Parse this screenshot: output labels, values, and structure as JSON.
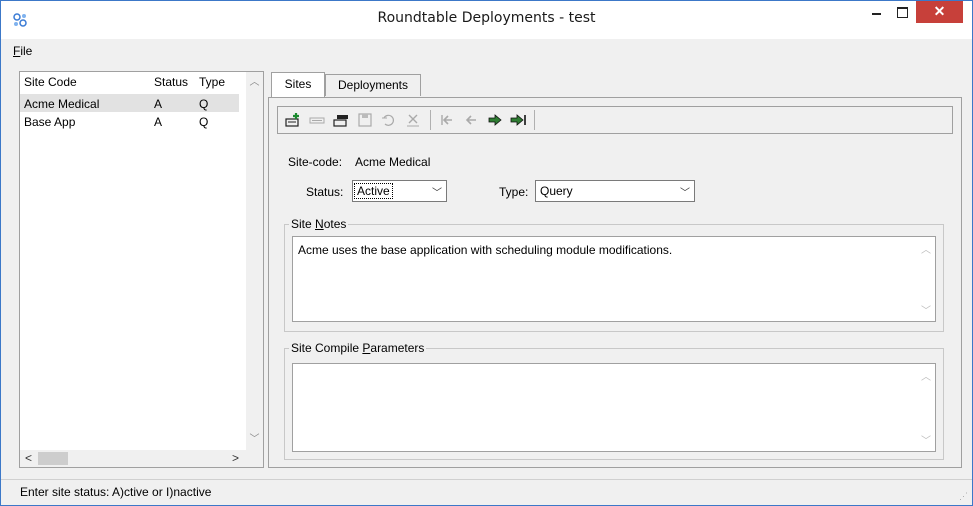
{
  "window": {
    "title": "Roundtable Deployments - test",
    "close_glyph": "✕",
    "app_icon": "roundtable-gear-icon"
  },
  "menu": {
    "file_accel": "F",
    "file_rest": "ile"
  },
  "site_list": {
    "headers": {
      "site_code": "Site Code",
      "status": "Status",
      "type": "Type"
    },
    "rows": [
      {
        "site_code": "Acme Medical",
        "status": "A",
        "type": "Q",
        "selected": true
      },
      {
        "site_code": "Base App",
        "status": "A",
        "type": "Q",
        "selected": false
      }
    ]
  },
  "tabs": [
    {
      "label": "Sites",
      "active": true
    },
    {
      "label": "Deployments",
      "active": false
    }
  ],
  "toolbar": {
    "buttons": [
      "add-record-icon",
      "insert-icon",
      "copy-record-icon",
      "save-icon",
      "undo-icon",
      "delete-icon",
      "first-record-icon",
      "previous-record-icon",
      "next-record-icon",
      "last-record-icon"
    ]
  },
  "form": {
    "site_code_label": "Site-code:",
    "site_code_value": "Acme Medical",
    "status_label": "Status:",
    "status_value": "Active",
    "type_label": "Type:",
    "type_value": "Query",
    "site_notes_legend_pre": "Site ",
    "site_notes_legend_accel": "N",
    "site_notes_legend_post": "otes",
    "site_notes_value": "Acme uses the base application with scheduling module modifications.",
    "compile_legend_pre": "Site Compile ",
    "compile_legend_accel": "P",
    "compile_legend_post": "arameters",
    "compile_value": ""
  },
  "status_bar": {
    "text": "Enter site status:  A)ctive or I)nactive"
  },
  "colors": {
    "close": "#c7403a",
    "accent_green": "#2e7d32",
    "selected_row": "#e2e2e2"
  }
}
